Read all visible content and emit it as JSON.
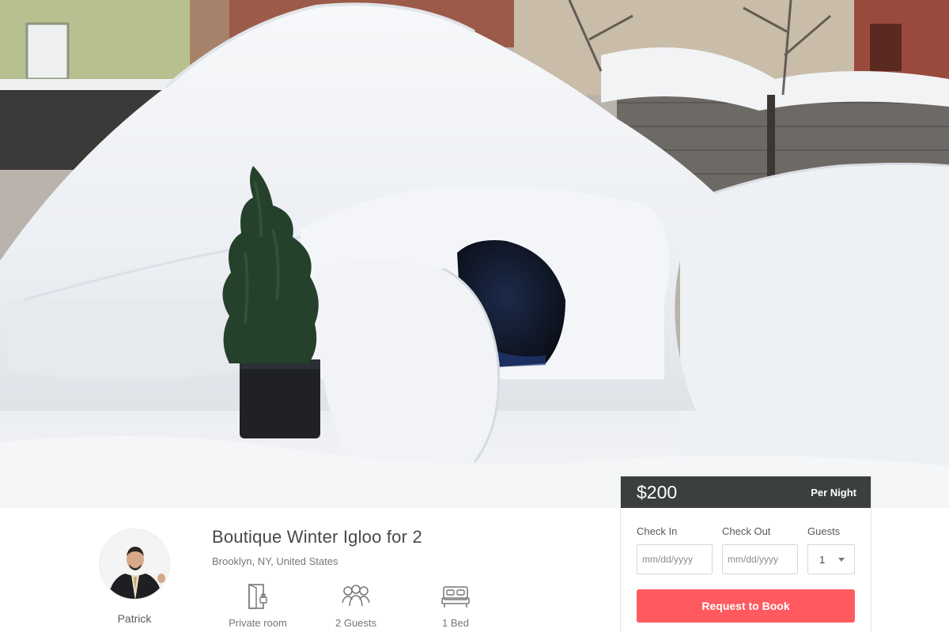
{
  "listing": {
    "title": "Boutique Winter Igloo for 2",
    "location": "Brooklyn, NY, United States"
  },
  "host": {
    "name": "Patrick"
  },
  "amenities": [
    {
      "icon": "door-icon",
      "label": "Private room"
    },
    {
      "icon": "guests-icon",
      "label": "2 Guests"
    },
    {
      "icon": "bed-icon",
      "label": "1 Bed"
    }
  ],
  "booking": {
    "price": "$200",
    "per_night": "Per Night",
    "check_in_label": "Check In",
    "check_out_label": "Check Out",
    "guests_label": "Guests",
    "check_in_placeholder": "mm/dd/yyyy",
    "check_out_placeholder": "mm/dd/yyyy",
    "guests_value": "1",
    "request_button": "Request to Book"
  },
  "colors": {
    "accent": "#ff5a5f",
    "price_bar": "#3c3f40"
  }
}
